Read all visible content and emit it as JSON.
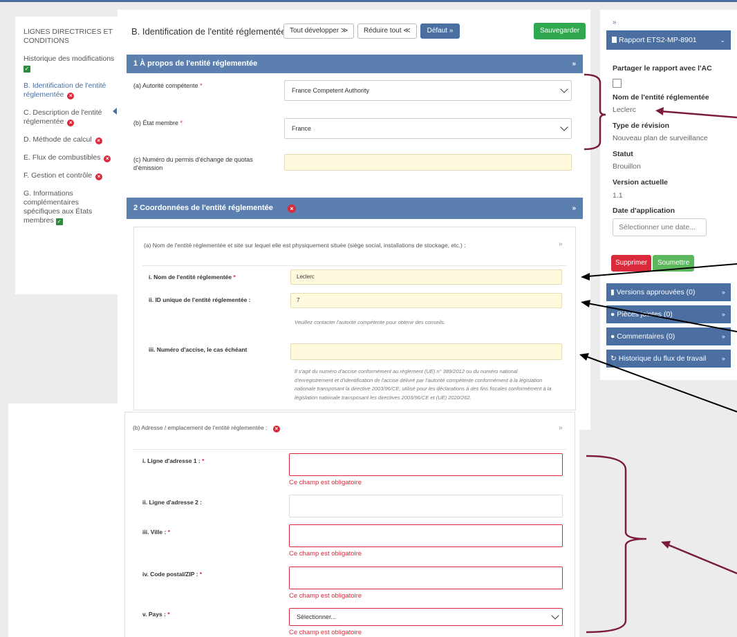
{
  "nav": {
    "items": [
      {
        "label": "LIGNES DIRECTRICES ET CONDITIONS",
        "status": ""
      },
      {
        "label": "Historique des modifications",
        "status": "ok"
      },
      {
        "label": "B. Identification de l'entité réglementée",
        "status": "error"
      },
      {
        "label": "C. Description de l'entité réglementée",
        "status": "error"
      },
      {
        "label": "D. Méthode de calcul",
        "status": "error"
      },
      {
        "label": "E. Flux de combustibles",
        "status": "error"
      },
      {
        "label": "F. Gestion et contrôle",
        "status": "error"
      },
      {
        "label": "G. Informations complémentaires spécifiques aux États membres",
        "status": "ok"
      }
    ]
  },
  "header": {
    "title": "B. Identification de l'entité réglementée",
    "expand_all": "Tout développer",
    "collapse_all": "Réduire tout",
    "default": "Défaut",
    "save": "Sauvegarder"
  },
  "section1": {
    "title": "1 À propos de l'entité réglementée",
    "authority_label": "(a) Autorité compétente",
    "authority_value": "France Competent Authority",
    "member_state_label": "(b) État membre",
    "member_state_value": "France",
    "permit_label": "(c) Numéro du permis d'échange de quotas d'émission",
    "permit_value": ""
  },
  "section2": {
    "title": "2 Coordonnées de l'entité réglementée",
    "sub_a": {
      "title": "(a) Nom de l'entité réglementée et site sur lequel elle est physiquement située (siège social, installations de stockage, etc.) :",
      "name_label": "i. Nom de l'entité réglementée",
      "name_value": "Leclerc",
      "uid_label": "ii. ID unique de l'entité réglementée :",
      "uid_value": "7",
      "uid_hint": "Veuillez contacter l'autorité compétente pour obtenir des conseils.",
      "excise_label": "iii. Numéro d'accise, le cas échéant",
      "excise_value": "",
      "excise_hint": "Il s'agit du numéro d'accise conformément au règlement (UE) n° 389/2012 ou du numéro national d'enregistrement et d'identification de l'accise délivré par l'autorité compétente conformément à la législation nationale transposant la directive 2003/96/CE, utilisé pour les déclarations à des fins fiscales conformément à la législation nationale transposant les directives 2003/96/CE et (UE) 2020/262."
    },
    "sub_b": {
      "title": "(b) Adresse / emplacement de l'entité réglementée :",
      "addr1_label": "i. Ligne d'adresse 1 :",
      "addr2_label": "ii. Ligne d'adresse 2 :",
      "city_label": "iii. Ville :",
      "zip_label": "iv. Code postal/ZIP :",
      "country_label": "v. Pays :",
      "country_placeholder": "Sélectionner...",
      "required_msg": "Ce champ est obligatoire"
    }
  },
  "sidebar": {
    "expand": "»",
    "report": "Rapport ETS2-MP-8901",
    "share_label": "Partager le rapport avec l'AC",
    "entity_label": "Nom de l'entité réglementée",
    "entity_value": "Leclerc",
    "revision_label": "Type de révision",
    "revision_value": "Nouveau plan de surveillance",
    "status_label": "Statut",
    "status_value": "Brouillon",
    "version_label": "Version actuelle",
    "version_value": "1.1",
    "date_label": "Date d'application",
    "date_placeholder": "Sélectionner une date...",
    "delete": "Supprimer",
    "submit": "Soumettre",
    "approved": "Versions approuvées (0)",
    "attachments": "Pièces jointes (0)",
    "comments": "Commentaires (0)",
    "workflow": "Historique du flux de travail"
  },
  "colors": {
    "accent": "#4a6fa0",
    "error": "#d9293a",
    "success": "#2fa84f"
  }
}
